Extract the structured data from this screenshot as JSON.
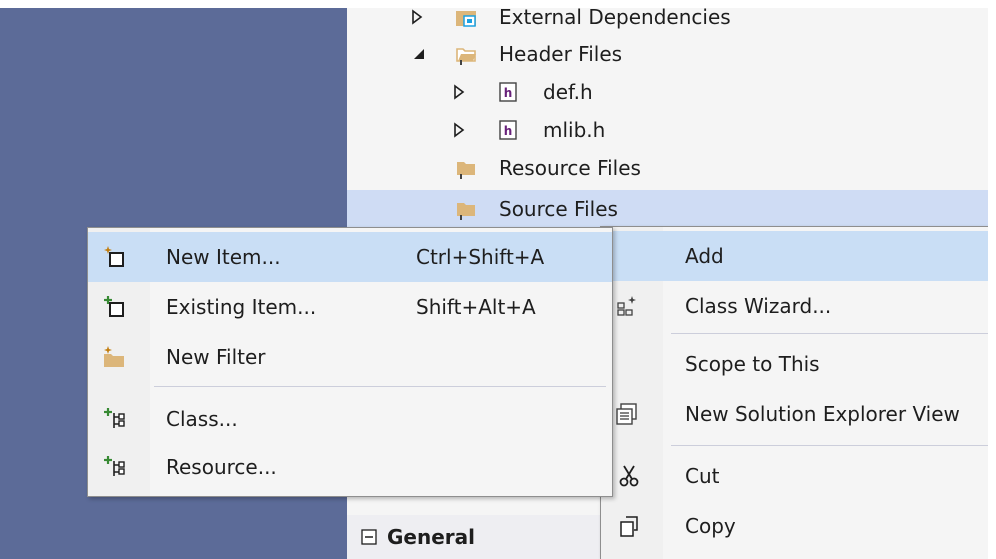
{
  "tree": {
    "items": [
      {
        "label": "External Dependencies",
        "expander": "collapsed"
      },
      {
        "label": "Header Files",
        "expander": "expanded"
      },
      {
        "label": "def.h",
        "expander": "collapsed"
      },
      {
        "label": "mlib.h",
        "expander": "collapsed"
      },
      {
        "label": "Resource Files",
        "expander": "none"
      },
      {
        "label": "Source Files",
        "expander": "none"
      }
    ],
    "partial_item": "Source Files",
    "general_label": "General"
  },
  "context_menu": {
    "items": [
      {
        "label": "Add",
        "icon": "none"
      },
      {
        "label": "Class Wizard...",
        "icon": "class-wizard-icon"
      },
      {
        "label": "Scope to This",
        "icon": "none"
      },
      {
        "label": "New Solution Explorer View",
        "icon": "new-view-icon"
      },
      {
        "label": "Cut",
        "icon": "scissors-icon"
      },
      {
        "label": "Copy",
        "icon": "copy-icon"
      }
    ]
  },
  "add_submenu": {
    "items": [
      {
        "label": "New Item...",
        "shortcut": "Ctrl+Shift+A",
        "icon": "new-item-icon"
      },
      {
        "label": "Existing Item...",
        "shortcut": "Shift+Alt+A",
        "icon": "existing-item-icon"
      },
      {
        "label": "New Filter",
        "shortcut": "",
        "icon": "new-filter-icon"
      },
      {
        "label": "Class...",
        "shortcut": "",
        "icon": "add-class-icon"
      },
      {
        "label": "Resource...",
        "shortcut": "",
        "icon": "add-resource-icon"
      }
    ]
  },
  "colors": {
    "left_pane": "#5c6b98",
    "selection": "#cfdcf4",
    "menu_highlight": "#c9def5",
    "folder": "#dcb67a",
    "header_file": "#68217a"
  }
}
